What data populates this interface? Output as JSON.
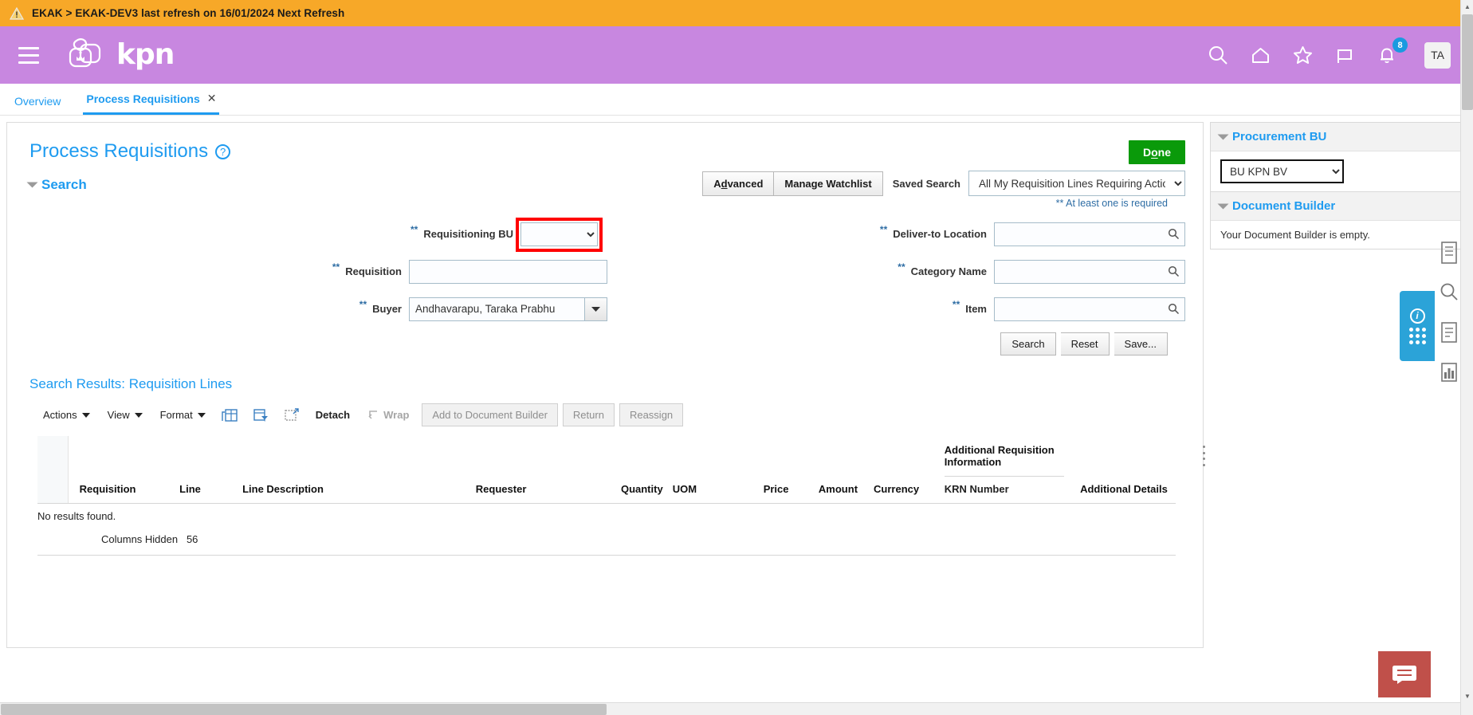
{
  "banner": {
    "icon": "warning-icon",
    "text": "EKAK > EKAK-DEV3 last refresh on 16/01/2024 Next Refresh"
  },
  "header": {
    "menu_icon": "hamburger-menu-icon",
    "logo_text": "kpn",
    "icons": [
      {
        "name": "search-icon"
      },
      {
        "name": "home-icon"
      },
      {
        "name": "favorites-star-icon"
      },
      {
        "name": "flag-icon"
      },
      {
        "name": "notifications-bell-icon",
        "badge": "8"
      }
    ],
    "avatar": "TA",
    "brand_color": "#c887e0",
    "badge_color": "#1a9ae0"
  },
  "tabs": [
    {
      "label": "Overview",
      "active": false
    },
    {
      "label": "Process Requisitions",
      "active": true,
      "close": "✕"
    }
  ],
  "page": {
    "title": "Process Requisitions",
    "help_icon": "help-question-icon",
    "done_label_pre": "D",
    "done_label_key": "o",
    "done_label_post": "ne"
  },
  "search": {
    "section_title": "Search",
    "advanced_pre": "A",
    "advanced_key": "d",
    "advanced_post": "vanced",
    "manage_watchlist": "Manage Watchlist",
    "saved_search_label": "Saved Search",
    "saved_search_value": "All My Requisition Lines Requiring Action",
    "required_note": "** At least one is required",
    "required_mark": "**",
    "left_fields": [
      {
        "label": "Requisitioning BU",
        "type": "select",
        "value": "",
        "highlight": true
      },
      {
        "label": "Requisition",
        "type": "text",
        "value": ""
      },
      {
        "label": "Buyer",
        "type": "combo",
        "value": "Andhavarapu, Taraka Prabhu"
      }
    ],
    "right_fields": [
      {
        "label": "Deliver-to Location",
        "type": "lov",
        "value": ""
      },
      {
        "label": "Category Name",
        "type": "lov",
        "value": ""
      },
      {
        "label": "Item",
        "type": "lov",
        "value": ""
      }
    ],
    "actions": [
      "Search",
      "Reset",
      "Save..."
    ]
  },
  "results": {
    "title": "Search Results: Requisition Lines",
    "toolbar": {
      "menus": [
        "Actions",
        "View",
        "Format"
      ],
      "icons": [
        {
          "name": "freeze-columns-icon"
        },
        {
          "name": "detach-filter-icon"
        },
        {
          "name": "detach-icon"
        }
      ],
      "detach": "Detach",
      "wrap": "Wrap",
      "wrap_icon": "wrap-icon",
      "buttons": [
        "Add to Document Builder",
        "Return",
        "Reassign"
      ]
    },
    "columns": [
      "Requisition",
      "Line",
      "Line Description",
      "Requester",
      "Quantity",
      "UOM",
      "Price",
      "Amount",
      "Currency"
    ],
    "group_column": "Additional Requisition Information",
    "group_subcolumn": "KRN Number",
    "last_column": "Additional Details",
    "empty_message": "No results found.",
    "columns_hidden_label": "Columns Hidden",
    "columns_hidden_count": "56"
  },
  "side": {
    "procurement_bu": {
      "title": "Procurement BU",
      "value": "BU KPN BV"
    },
    "document_builder": {
      "title": "Document Builder",
      "message": "Your Document Builder is empty."
    }
  },
  "rail": {
    "icons": [
      {
        "name": "document-icon"
      },
      {
        "name": "search-panel-icon"
      },
      {
        "name": "notes-icon"
      },
      {
        "name": "analytics-bar-icon"
      }
    ],
    "card_icon": "info-apps-icon"
  },
  "chat": {
    "icon": "chat-bubble-icon",
    "color": "#c0504a"
  }
}
